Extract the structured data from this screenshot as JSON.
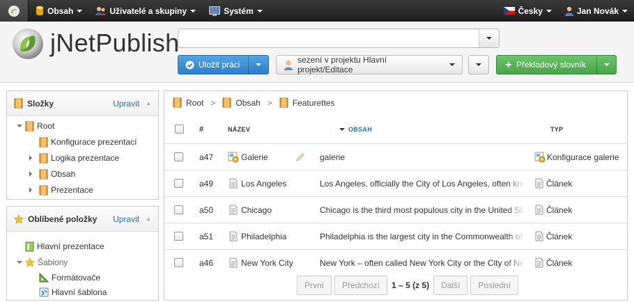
{
  "topbar": {
    "menus": [
      {
        "label": "Obsah",
        "icon": "database-icon"
      },
      {
        "label": "Uživatelé a skupiny",
        "icon": "users-icon"
      },
      {
        "label": "Systém",
        "icon": "system-icon"
      }
    ],
    "language": "Česky",
    "user": "Jan Novák"
  },
  "header": {
    "logo_text": "jNetPublish",
    "search_value": "",
    "save_button": "Uložit práci",
    "session_button": "sezení v projektu Hlavní projekt/Editace",
    "dictionary_button": "Překladový slovník"
  },
  "folders_panel": {
    "title": "Složky",
    "edit_link": "Upravit",
    "tree": {
      "root": "Root",
      "children": [
        "Konfigurace prezentací",
        "Logika prezentace",
        "Obsah",
        "Prezentace"
      ]
    }
  },
  "favorites_panel": {
    "title": "Oblíbené položky",
    "edit_link": "Upravit",
    "items": {
      "main_presentation": "Hlavní prezentace",
      "templates": "Šablony",
      "formatters": "Formátovače",
      "main_template": "Hlavní šablona"
    }
  },
  "breadcrumb": [
    "Root",
    "Obsah",
    "Featurettes"
  ],
  "table": {
    "headers": {
      "id": "#",
      "name": "NÁZEV",
      "content": "OBSAH",
      "type": "TYP"
    },
    "rows": [
      {
        "id": "a47",
        "name": "Galerie",
        "content": "galerie",
        "type": "Konfigurace galerie"
      },
      {
        "id": "a49",
        "name": "Los Angeles",
        "content": "Los Angeles, officially the City of Los Angeles, often kno",
        "type": "Článek"
      },
      {
        "id": "a50",
        "name": "Chicago",
        "content": "Chicago is the third most populous city in the United St",
        "type": "Článek"
      },
      {
        "id": "a51",
        "name": "Philadelphia",
        "content": "Philadelphia is the largest city in the Commonwealth of",
        "type": "Článek"
      },
      {
        "id": "a46",
        "name": "New York City",
        "content": "New York – often called New York City or the City of New",
        "type": "Článek"
      }
    ]
  },
  "pager": {
    "first": "První",
    "prev": "Předchozí",
    "info": "1 – 5 (z 5)",
    "next": "Další",
    "last": "Poslední"
  }
}
